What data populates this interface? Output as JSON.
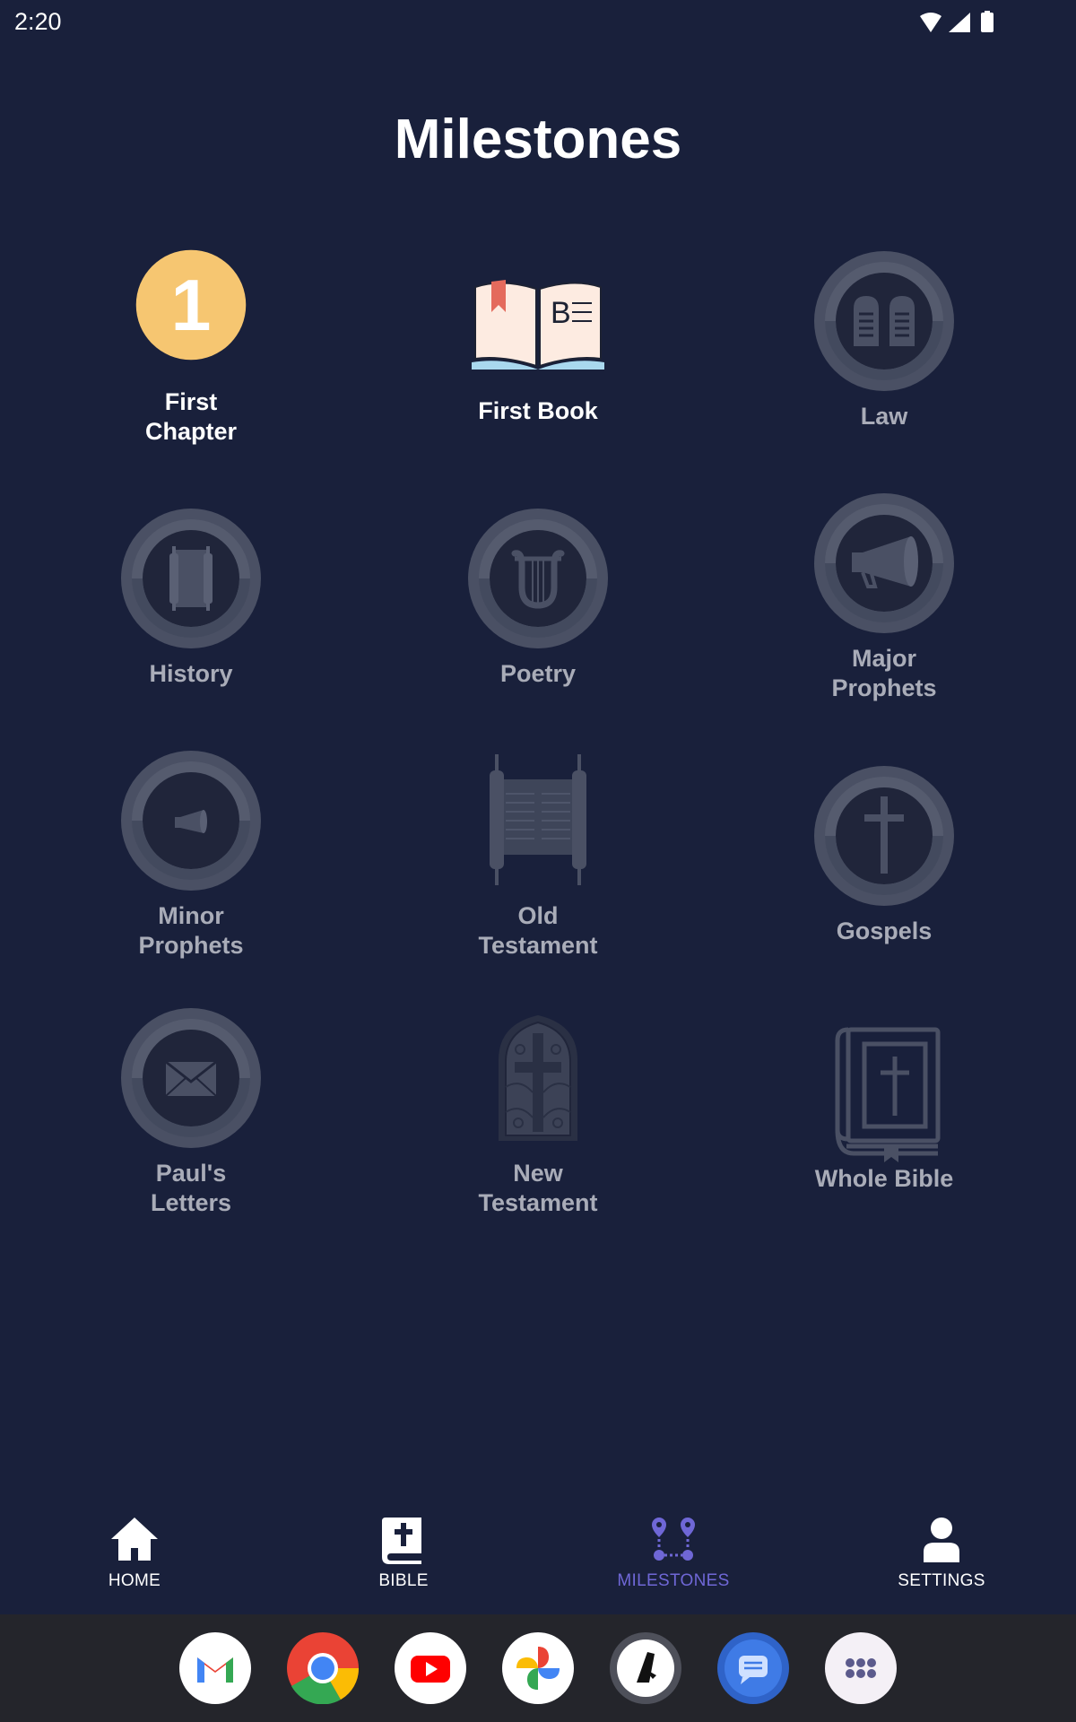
{
  "status_bar": {
    "time": "2:20"
  },
  "page": {
    "title": "Milestones"
  },
  "milestones": [
    {
      "label": "First\nChapter",
      "icon": "number-one-icon",
      "earned": true
    },
    {
      "label": "First Book",
      "icon": "open-book-icon",
      "earned": true
    },
    {
      "label": "Law",
      "icon": "stone-tablets-icon",
      "earned": false
    },
    {
      "label": "History",
      "icon": "scroll-icon",
      "earned": false
    },
    {
      "label": "Poetry",
      "icon": "lyre-icon",
      "earned": false
    },
    {
      "label": "Major\nProphets",
      "icon": "megaphone-icon",
      "earned": false
    },
    {
      "label": "Minor\nProphets",
      "icon": "small-megaphone-icon",
      "earned": false
    },
    {
      "label": "Old\nTestament",
      "icon": "torah-scroll-icon",
      "earned": false
    },
    {
      "label": "Gospels",
      "icon": "cross-icon",
      "earned": false
    },
    {
      "label": "Paul's\nLetters",
      "icon": "envelope-icon",
      "earned": false
    },
    {
      "label": "New\nTestament",
      "icon": "stained-glass-window-icon",
      "earned": false
    },
    {
      "label": "Whole Bible",
      "icon": "bible-book-icon",
      "earned": false
    }
  ],
  "badge_one_text": "1",
  "bottom_nav": [
    {
      "label": "HOME",
      "icon": "home-icon",
      "active": false
    },
    {
      "label": "BIBLE",
      "icon": "bible-icon",
      "active": false
    },
    {
      "label": "MILESTONES",
      "icon": "milestones-route-icon",
      "active": true
    },
    {
      "label": "SETTINGS",
      "icon": "person-icon",
      "active": false
    }
  ],
  "dock": [
    {
      "name": "gmail-icon"
    },
    {
      "name": "chrome-icon"
    },
    {
      "name": "youtube-icon"
    },
    {
      "name": "photos-icon"
    },
    {
      "name": "bible-app-icon"
    },
    {
      "name": "messages-icon"
    },
    {
      "name": "app-drawer-icon"
    }
  ],
  "colors": {
    "background": "#19203b",
    "accent": "#6f67d6",
    "badge_gold": "#f6c671",
    "locked_ring": "#4a5064",
    "locked_inner": "#20253a",
    "dock_bg": "#24252b"
  }
}
